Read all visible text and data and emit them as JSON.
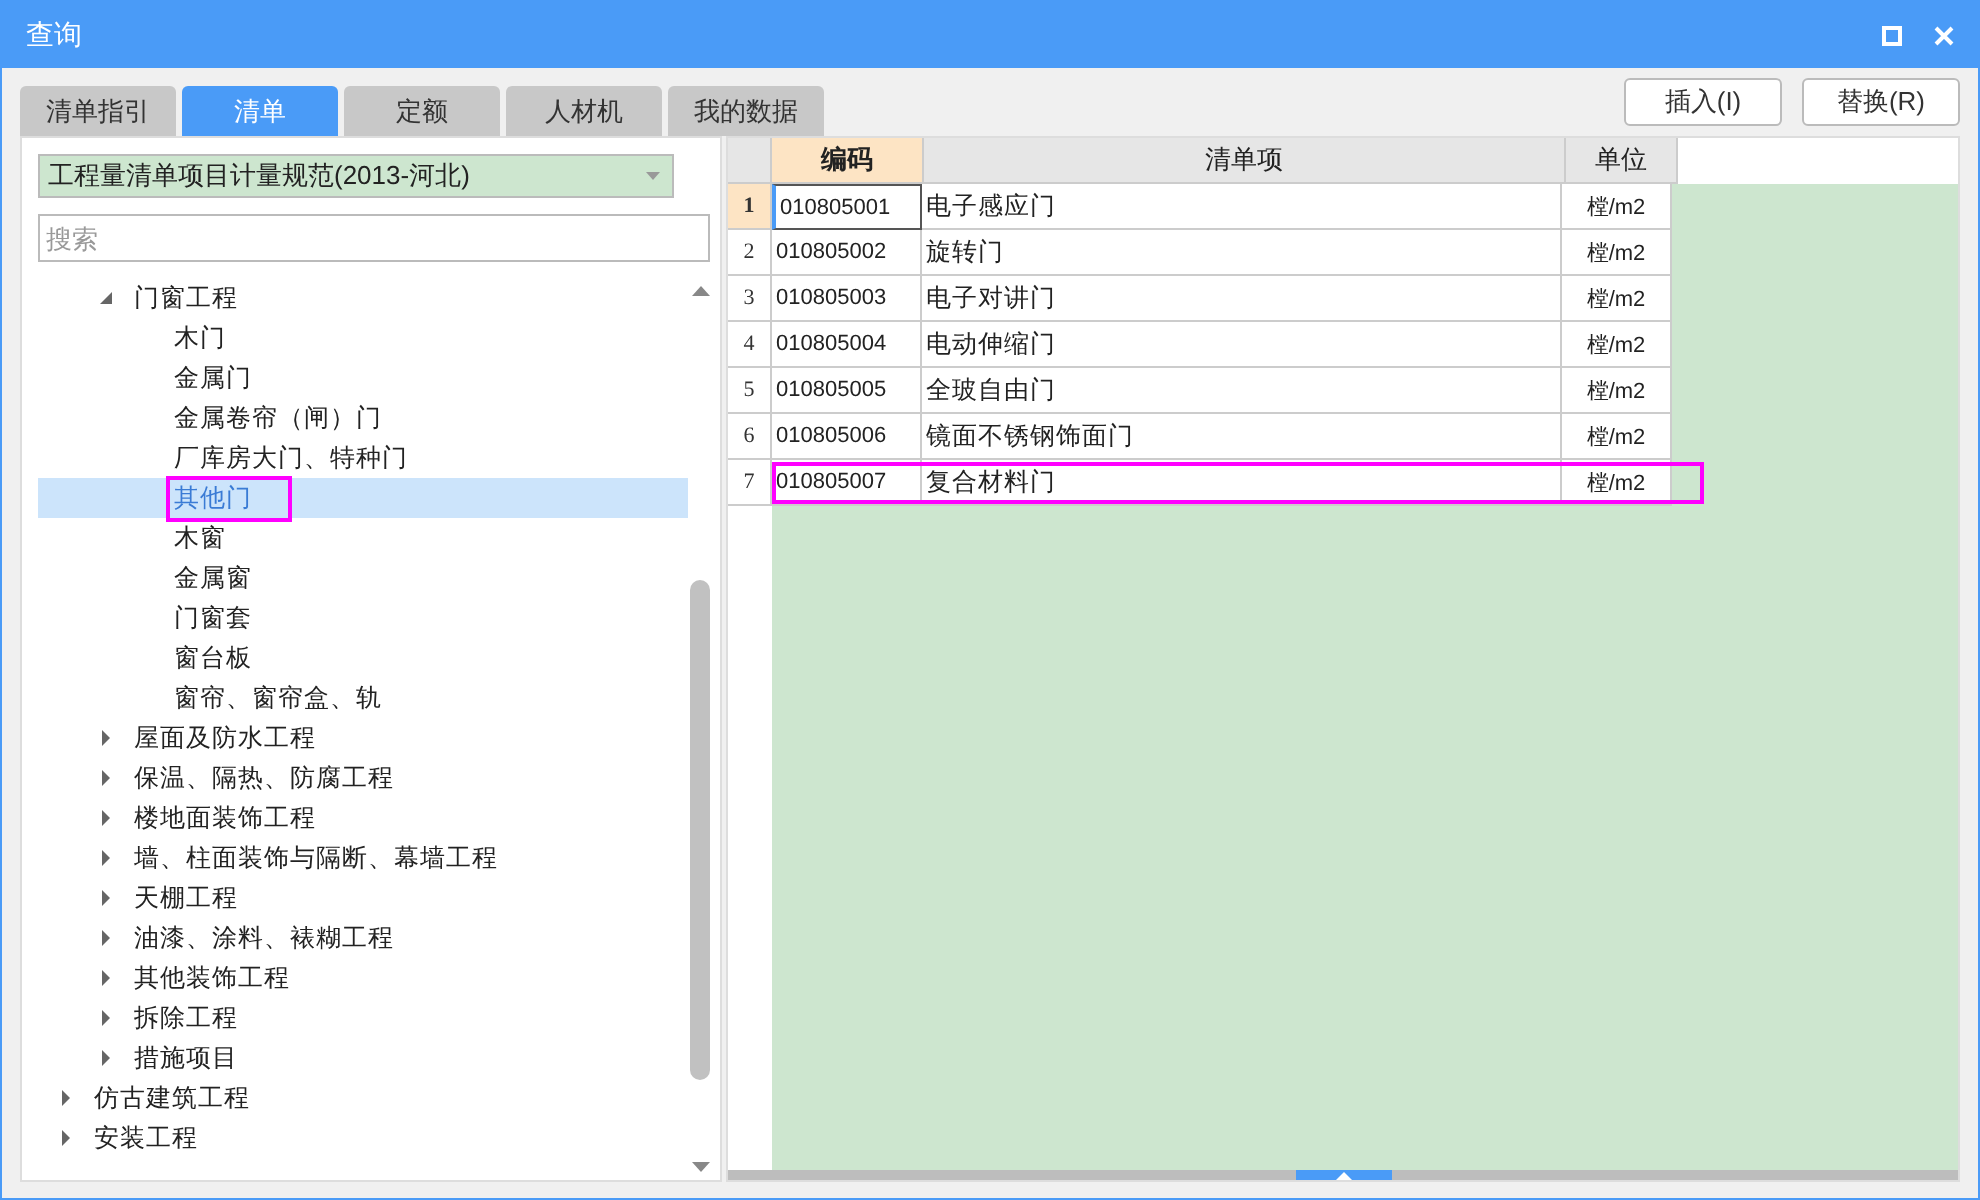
{
  "window": {
    "title": "查询"
  },
  "tabs": [
    {
      "label": "清单指引",
      "selected": false
    },
    {
      "label": "清单",
      "selected": true
    },
    {
      "label": "定额",
      "selected": false
    },
    {
      "label": "人材机",
      "selected": false
    },
    {
      "label": "我的数据",
      "selected": false
    }
  ],
  "actions": [
    "插入(I)",
    "替换(R)"
  ],
  "library_select": {
    "value": "工程量清单项目计量规范(2013-河北)"
  },
  "search": {
    "placeholder": "搜索"
  },
  "tree": {
    "scrolled_parent_children": [
      {
        "label": "门窗工程",
        "expanded": true,
        "children": [
          {
            "label": "木门",
            "selected": false,
            "highlighted": false
          },
          {
            "label": "金属门",
            "selected": false,
            "highlighted": false
          },
          {
            "label": "金属卷帘（闸）门",
            "selected": false,
            "highlighted": false
          },
          {
            "label": "厂库房大门、特种门",
            "selected": false,
            "highlighted": false
          },
          {
            "label": "其他门",
            "selected": true,
            "highlighted": true
          },
          {
            "label": "木窗",
            "selected": false,
            "highlighted": false
          },
          {
            "label": "金属窗",
            "selected": false,
            "highlighted": false
          },
          {
            "label": "门窗套",
            "selected": false,
            "highlighted": false
          },
          {
            "label": "窗台板",
            "selected": false,
            "highlighted": false
          },
          {
            "label": "窗帘、窗帘盒、轨",
            "selected": false,
            "highlighted": false
          }
        ]
      },
      {
        "label": "屋面及防水工程",
        "expanded": false
      },
      {
        "label": "保温、隔热、防腐工程",
        "expanded": false
      },
      {
        "label": "楼地面装饰工程",
        "expanded": false
      },
      {
        "label": "墙、柱面装饰与隔断、幕墙工程",
        "expanded": false
      },
      {
        "label": "天棚工程",
        "expanded": false
      },
      {
        "label": "油漆、涂料、裱糊工程",
        "expanded": false
      },
      {
        "label": "其他装饰工程",
        "expanded": false
      },
      {
        "label": "拆除工程",
        "expanded": false
      },
      {
        "label": "措施项目",
        "expanded": false
      }
    ],
    "items": [
      {
        "label": "仿古建筑工程",
        "expanded": false
      },
      {
        "label": "安装工程",
        "expanded": false
      }
    ]
  },
  "table": {
    "columns": [
      {
        "label": "编码",
        "selected": true
      },
      {
        "label": "清单项",
        "selected": false
      },
      {
        "label": "单位",
        "selected": false
      }
    ],
    "rows": [
      {
        "number": "1",
        "code": "010805001",
        "item": "电子感应门",
        "unit": "樘/m2",
        "selected": true,
        "highlighted": false
      },
      {
        "number": "2",
        "code": "010805002",
        "item": "旋转门",
        "unit": "樘/m2",
        "selected": false,
        "highlighted": false
      },
      {
        "number": "3",
        "code": "010805003",
        "item": "电子对讲门",
        "unit": "樘/m2",
        "selected": false,
        "highlighted": false
      },
      {
        "number": "4",
        "code": "010805004",
        "item": "电动伸缩门",
        "unit": "樘/m2",
        "selected": false,
        "highlighted": false
      },
      {
        "number": "5",
        "code": "010805005",
        "item": "全玻自由门",
        "unit": "樘/m2",
        "selected": false,
        "highlighted": false
      },
      {
        "number": "6",
        "code": "010805006",
        "item": "镜面不锈钢饰面门",
        "unit": "樘/m2",
        "selected": false,
        "highlighted": false
      },
      {
        "number": "7",
        "code": "010805007",
        "item": "复合材料门",
        "unit": "樘/m2",
        "selected": false,
        "highlighted": true
      }
    ]
  }
}
